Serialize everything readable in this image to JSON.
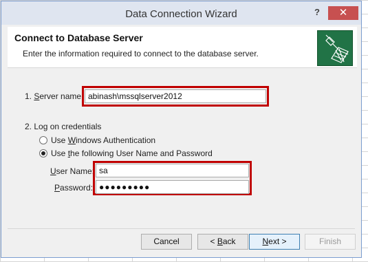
{
  "window": {
    "title": "Data Connection Wizard",
    "help_label": "?",
    "close_label": "✕"
  },
  "header": {
    "title": "Connect to Database Server",
    "subtitle": "Enter the information required to connect to the database server.",
    "icon": "database-connection-icon"
  },
  "server": {
    "label_prefix": "1. ",
    "label_access": "S",
    "label_rest": "erver name:",
    "value": "abinash\\mssqlserver2012"
  },
  "credentials": {
    "heading": "2. Log on credentials",
    "options": [
      {
        "pre": "Use ",
        "access": "W",
        "post": "indows Authentication",
        "selected": false
      },
      {
        "pre": "Use ",
        "access": "t",
        "post": "he following User Name and Password",
        "selected": true
      }
    ],
    "username": {
      "label_access": "U",
      "label_rest": "ser Name:",
      "value": "sa"
    },
    "password": {
      "label_access": "P",
      "label_rest": "assword:",
      "value": "●●●●●●●●●"
    }
  },
  "buttons": {
    "cancel": "Cancel",
    "back_pre": "< ",
    "back_access": "B",
    "back_post": "ack",
    "next_access": "N",
    "next_post": "ext >",
    "finish": "Finish"
  },
  "colors": {
    "highlight": "#c00000",
    "close_button": "#c75050",
    "icon_bg": "#217346"
  }
}
